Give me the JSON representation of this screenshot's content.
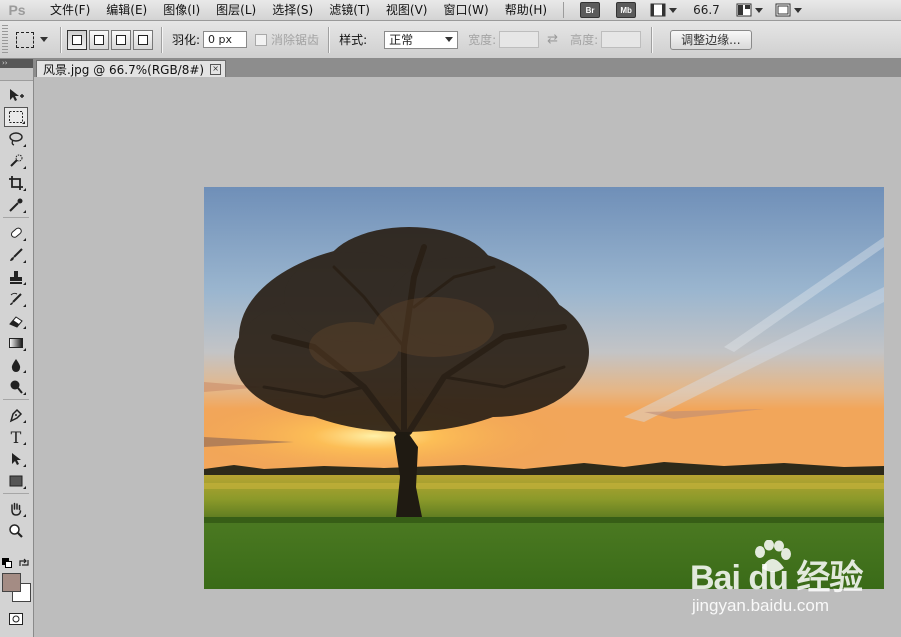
{
  "app": {
    "logo": "Ps"
  },
  "menu": [
    "文件(F)",
    "编辑(E)",
    "图像(I)",
    "图层(L)",
    "选择(S)",
    "滤镜(T)",
    "视图(V)",
    "窗口(W)",
    "帮助(H)"
  ],
  "appbar": {
    "bridge": "Br",
    "minibridge": "Mb",
    "zoom": "66.7"
  },
  "options": {
    "feather_label": "羽化:",
    "feather_value": "0 px",
    "antialias_label": "消除锯齿",
    "style_label": "样式:",
    "style_value": "正常",
    "width_label": "宽度:",
    "height_label": "高度:",
    "refine_edge_button": "调整边缘..."
  },
  "document": {
    "tab_title": "风景.jpg @ 66.7%(RGB/8#)",
    "close": "×"
  },
  "colors": {
    "foreground": "#a48c84",
    "background": "#ffffff"
  },
  "watermark": {
    "brand": "Bai du 经验",
    "url": "jingyan.baidu.com"
  }
}
